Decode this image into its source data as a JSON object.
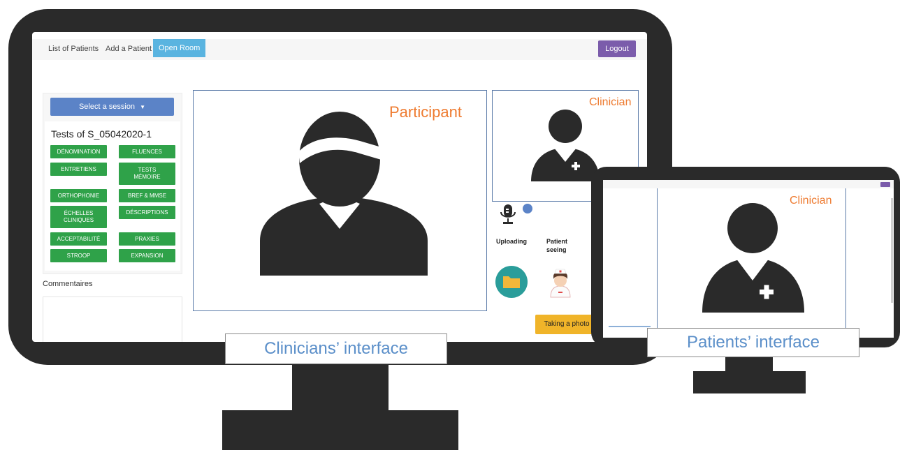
{
  "clinician_app": {
    "nav": {
      "list_patients": "List of Patients",
      "add_patient": "Add a Patient",
      "open_room": "Open Room",
      "logout": "Logout"
    },
    "session_select": "Select a session",
    "tests_title": "Tests of S_05042020-1",
    "test_buttons": [
      "DÉNOMINATION",
      "FLUENCES",
      "ENTRETIENS",
      "TESTS MÉMOIRE",
      "ORTHOPHONIE",
      "BREF & MMSE",
      "ÉCHELLES CLINIQUES",
      "DÉSCRIPTIONS",
      "ACCEPTABILITÉ",
      "PRAXIES",
      "STROOP",
      "EXPANSION"
    ],
    "comments_label": "Commentaires",
    "participant_label": "Participant",
    "clinician_label": "Clinician",
    "uploading_label": "Uploading",
    "patient_seeing_label": "Patient seeing",
    "taking_photo": "Taking a photo"
  },
  "patient_app": {
    "clinician_label": "Clinician"
  },
  "captions": {
    "clinicians": "Clinicians’ interface",
    "patients": "Patients’ interface"
  },
  "colors": {
    "bezel": "#2a2a2a",
    "test_button": "#2fa249",
    "session_button": "#5b83c7",
    "open_room": "#5ab4e0",
    "logout": "#7b5cab",
    "video_label": "#ee7b30",
    "caption_text": "#5b8fc9",
    "photo_button": "#f0b429"
  },
  "icons": [
    "person-icon",
    "clinician-icon",
    "microphone-icon",
    "folder-icon",
    "nurse-icon"
  ]
}
